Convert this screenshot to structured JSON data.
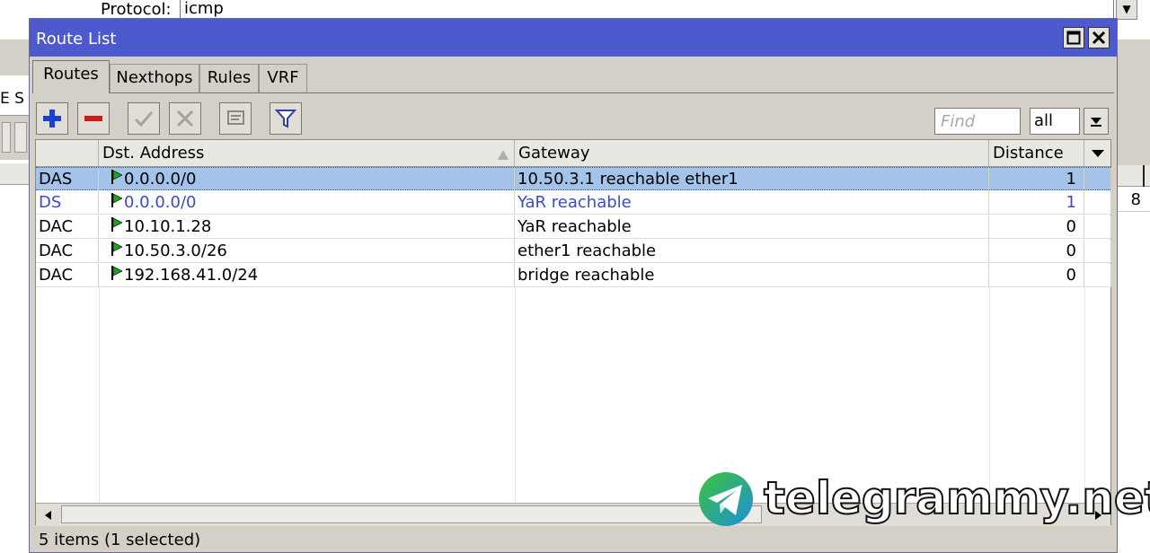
{
  "background": {
    "protocol_label": "Protocol:",
    "protocol_value": "icmp",
    "left_fragment": "E S",
    "right_cell_value": "8"
  },
  "window": {
    "title": "Route List",
    "tabs": [
      {
        "label": "Routes",
        "active": true
      },
      {
        "label": "Nexthops",
        "active": false
      },
      {
        "label": "Rules",
        "active": false
      },
      {
        "label": "VRF",
        "active": false
      }
    ],
    "toolbar": {
      "buttons": [
        {
          "name": "add",
          "icon": "plus-icon",
          "color": "#1c3fcf"
        },
        {
          "name": "remove",
          "icon": "minus-icon",
          "color": "#cc1c1c"
        },
        {
          "name": "enable",
          "icon": "check-icon"
        },
        {
          "name": "disable",
          "icon": "x-icon"
        },
        {
          "name": "comment",
          "icon": "comment-icon"
        },
        {
          "name": "filter",
          "icon": "filter-icon"
        }
      ],
      "find_placeholder": "Find",
      "scope_value": "all"
    },
    "table": {
      "columns": [
        "",
        "Dst. Address",
        "Gateway",
        "Distance"
      ],
      "sorted_column": "Dst. Address",
      "rows": [
        {
          "flags": "DAS",
          "dst": "0.0.0.0/0",
          "gateway": "10.50.3.1 reachable ether1",
          "distance": "1",
          "selected": true,
          "inactive": false
        },
        {
          "flags": "DS",
          "dst": "0.0.0.0/0",
          "gateway": "YaR reachable",
          "distance": "1",
          "selected": false,
          "inactive": true
        },
        {
          "flags": "DAC",
          "dst": "10.10.1.28",
          "gateway": "YaR reachable",
          "distance": "0",
          "selected": false,
          "inactive": false
        },
        {
          "flags": "DAC",
          "dst": "10.50.3.0/26",
          "gateway": "ether1 reachable",
          "distance": "0",
          "selected": false,
          "inactive": false
        },
        {
          "flags": "DAC",
          "dst": "192.168.41.0/24",
          "gateway": "bridge reachable",
          "distance": "0",
          "selected": false,
          "inactive": false
        }
      ]
    },
    "status": "5 items (1 selected)"
  },
  "watermark": {
    "text": "telegrammy.net"
  },
  "colors": {
    "titlebar": "#4c5acd",
    "selection": "#a4c3e8",
    "inactive_text": "#3d49c9",
    "route_flag": "#1aa51a"
  }
}
